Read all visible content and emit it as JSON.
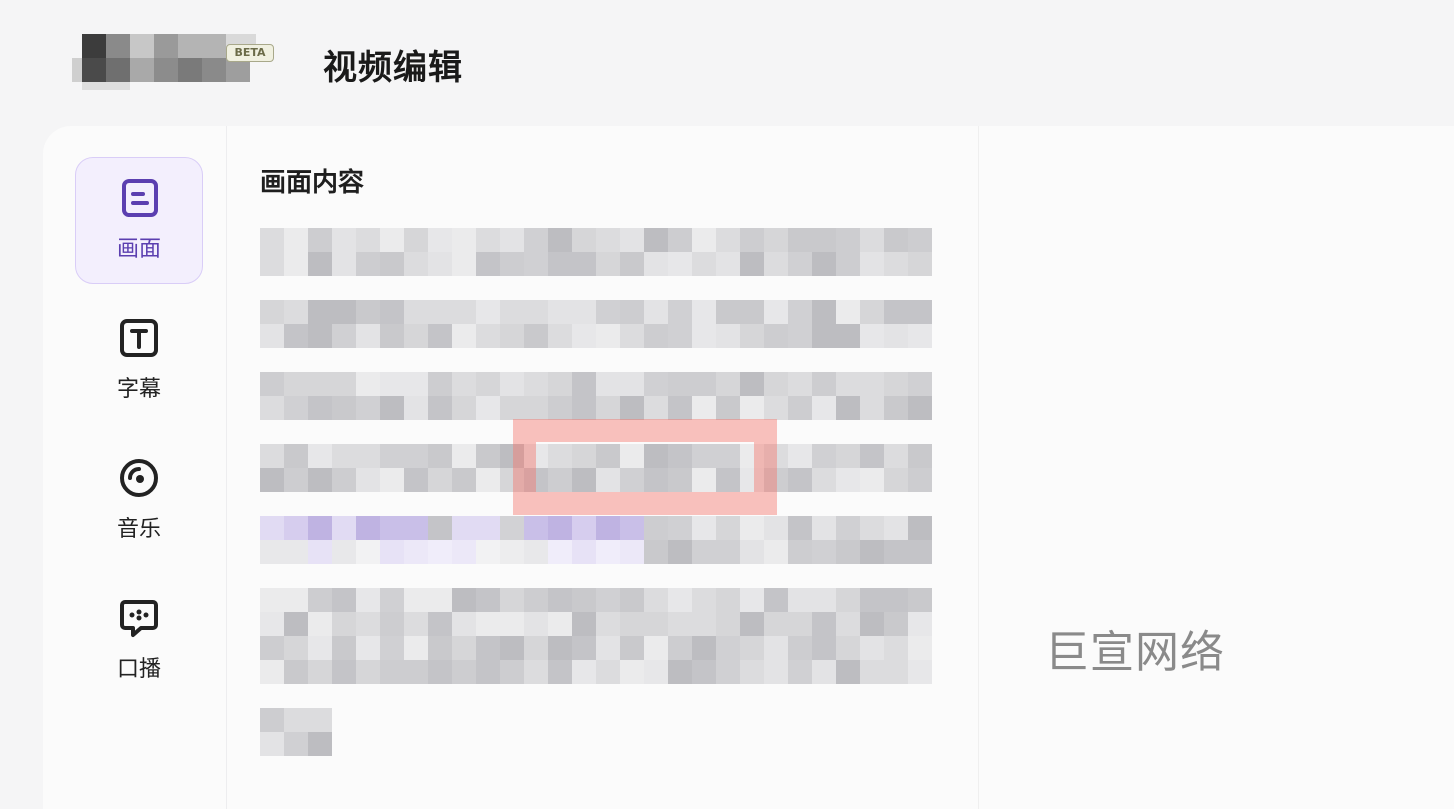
{
  "header": {
    "title": "视频编辑",
    "badge": "BETA"
  },
  "sidebar": {
    "items": [
      {
        "label": "画面",
        "icon": "document-icon",
        "active": true
      },
      {
        "label": "字幕",
        "icon": "text-box-icon",
        "active": false
      },
      {
        "label": "音乐",
        "icon": "music-disc-icon",
        "active": false
      },
      {
        "label": "口播",
        "icon": "speech-bubble-icon",
        "active": false
      }
    ]
  },
  "main": {
    "section_title": "画面内容"
  },
  "watermark": "巨宣网络",
  "colors": {
    "accent": "#5b3fb0",
    "active_bg": "#f3effd",
    "highlight": "#f4786e"
  }
}
